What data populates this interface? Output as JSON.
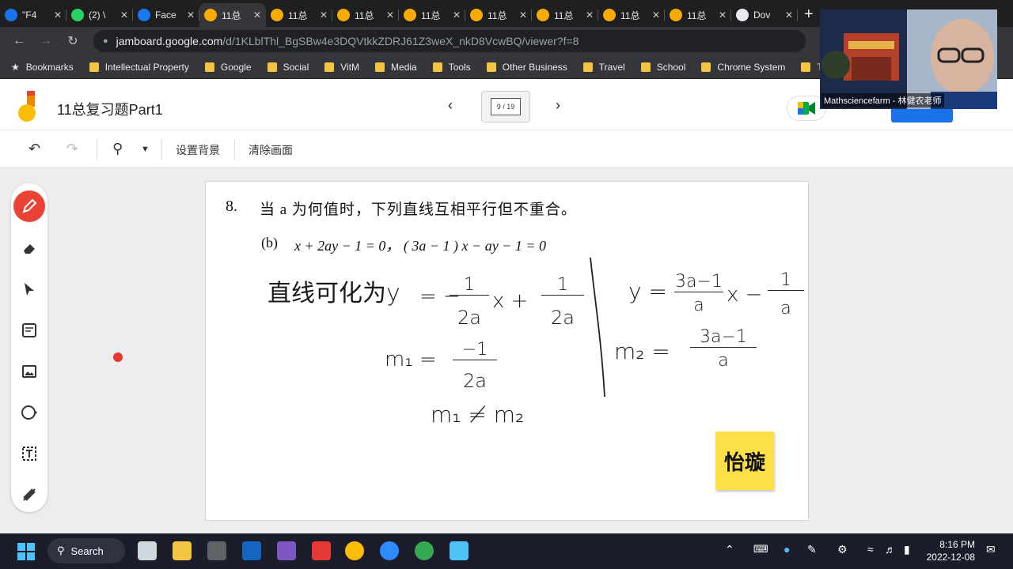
{
  "browser": {
    "tabs": [
      {
        "label": "\"F4",
        "favicon": "contacts-icon",
        "color": "#1a73e8"
      },
      {
        "label": "(2) \\",
        "favicon": "whatsapp-icon",
        "color": "#25d366"
      },
      {
        "label": "Face",
        "favicon": "facebook-icon",
        "color": "#1877f2"
      },
      {
        "label": "11总",
        "favicon": "jamboard-icon",
        "color": "#f9ab00",
        "active": true
      },
      {
        "label": "11总",
        "favicon": "jamboard-icon",
        "color": "#f9ab00"
      },
      {
        "label": "11总",
        "favicon": "jamboard-icon",
        "color": "#f9ab00"
      },
      {
        "label": "11总",
        "favicon": "jamboard-icon",
        "color": "#f9ab00"
      },
      {
        "label": "11总",
        "favicon": "jamboard-icon",
        "color": "#f9ab00"
      },
      {
        "label": "11总",
        "favicon": "jamboard-icon",
        "color": "#f9ab00"
      },
      {
        "label": "11总",
        "favicon": "jamboard-icon",
        "color": "#f9ab00"
      },
      {
        "label": "11总",
        "favicon": "jamboard-icon",
        "color": "#f9ab00"
      },
      {
        "label": "Dov",
        "favicon": "download-icon",
        "color": "#e8eaed"
      }
    ],
    "url_host": "jamboard.google.com",
    "url_path": "/d/1KLblThl_BgSBw4e3DQVtkkZDRJ61Z3weX_nkD8VcwBQ/viewer?f=8",
    "bookmarks": [
      "Bookmarks",
      "Intellectual Property",
      "Google",
      "Social",
      "VitM",
      "Media",
      "Tools",
      "Other Business",
      "Travel",
      "School",
      "Chrome System",
      "T"
    ]
  },
  "jamboard": {
    "title": "11总复习题Part1",
    "pager": "9 / 19",
    "toolbar": {
      "set_background": "设置背景",
      "clear_frame": "清除画面"
    },
    "accent": "#ea4335"
  },
  "slide": {
    "number": "8.",
    "question": "当 a 为何值时，下列直线互相平行但不重合。",
    "part": "(b)",
    "equation": "x + 2ay − 1 = 0， ( 3a − 1 ) x − ay − 1 = 0",
    "handwriting": {
      "line1_label": "直线可化为y",
      "line1_eq_a": "= −",
      "line1_frac1_num": "1",
      "line1_frac1_den": "2a",
      "line1_mid": "x +",
      "line1_frac2_num": "1",
      "line1_frac2_den": "2a",
      "m1_label": "m₁ =",
      "m1_num": "−1",
      "m1_den": "2a",
      "m_neq": "m₁ ≠ m₂",
      "line2_y": "y =",
      "line2_num": "3a−1",
      "line2_den": "a",
      "line2_mid": "x −",
      "line2_frac_num": "1",
      "line2_frac_den": "a",
      "m2_label": "m₂ =",
      "m2_num": "3a−1",
      "m2_den": "a"
    },
    "sticky_note": "怡璇"
  },
  "webcam": {
    "label": "Mathsciencefarm - 林健农老师"
  },
  "taskbar": {
    "search": "Search",
    "time": "8:16 PM",
    "date": "2022-12-08"
  }
}
